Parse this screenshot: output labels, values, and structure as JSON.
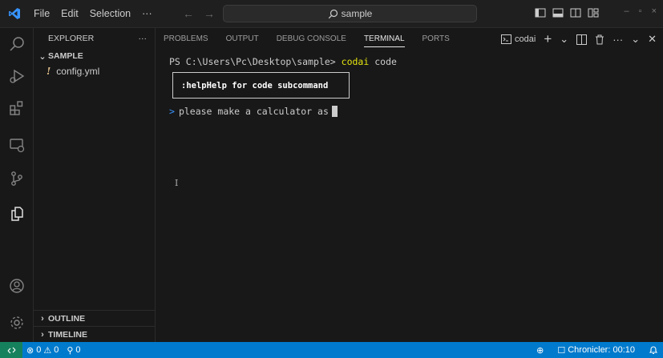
{
  "titlebar": {
    "menu": [
      "File",
      "Edit",
      "Selection"
    ],
    "more": "···",
    "search_text": "sample",
    "window_controls": [
      "–",
      "▫",
      "×"
    ]
  },
  "sidebar": {
    "title": "EXPLORER",
    "more": "···",
    "folder": "SAMPLE",
    "files": [
      {
        "icon": "!",
        "name": "config.yml"
      }
    ],
    "sections": [
      "OUTLINE",
      "TIMELINE"
    ]
  },
  "panel": {
    "tabs": [
      "PROBLEMS",
      "OUTPUT",
      "DEBUG CONSOLE",
      "TERMINAL",
      "PORTS"
    ],
    "active_tab": "TERMINAL",
    "terminal_name": "codai",
    "plus": "+",
    "chevron": "⌄",
    "more": "···",
    "close": "✕"
  },
  "terminal": {
    "prompt_path": "PS C:\\Users\\Pc\\Desktop\\sample>",
    "cmd": "codai",
    "arg": "code",
    "popup_cmd": ":help",
    "popup_desc": "Help for code subcommand",
    "prompt_marker": ">",
    "input_text": "please make a calculator as",
    "ibeam": "I"
  },
  "status": {
    "errors": "0",
    "warnings": "0",
    "ports": "0",
    "chronicler": "Chronicler: 00:10"
  },
  "colors": {
    "accent": "#007acc",
    "remote": "#16825d",
    "command_yellow": "#e5e510",
    "prompt_blue": "#3794ff"
  }
}
